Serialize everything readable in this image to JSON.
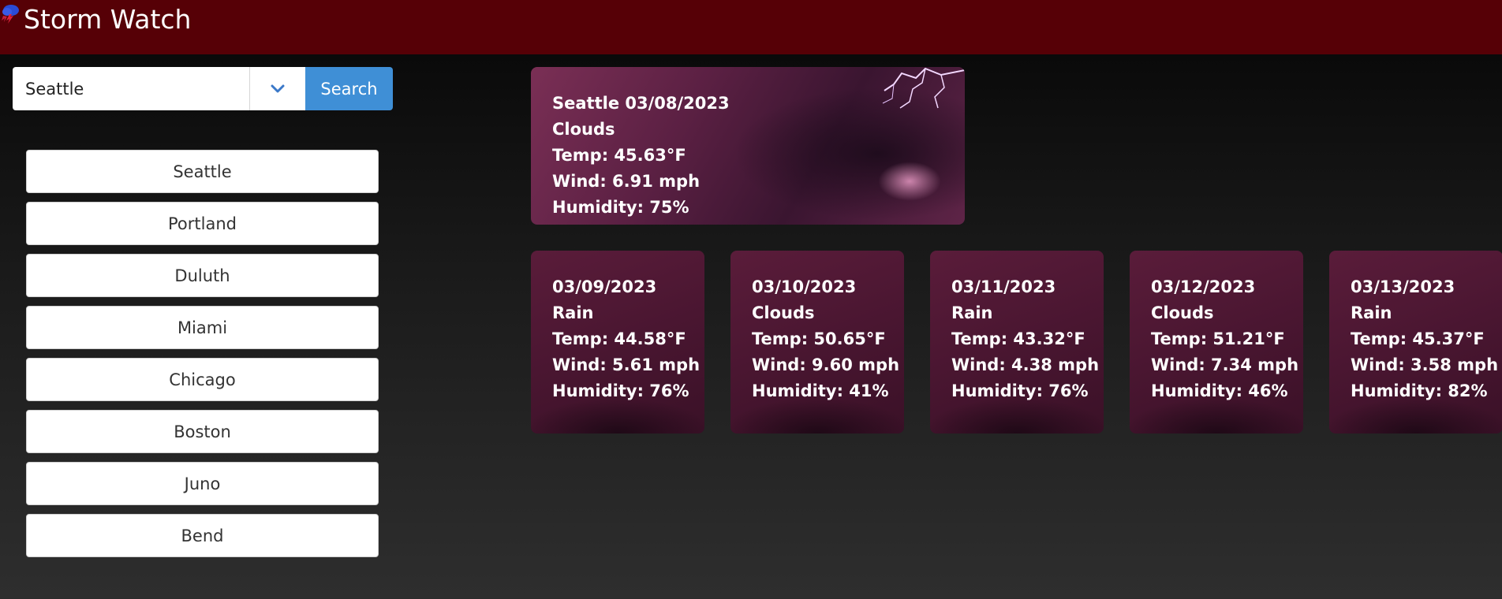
{
  "app": {
    "title": "Storm Watch",
    "logo_icon": "storm-logo-icon"
  },
  "search": {
    "value": "Seattle",
    "dropdown_icon": "chevron-down-icon",
    "button_label": "Search",
    "accent_color": "#3f8fd6"
  },
  "history": [
    "Seattle",
    "Portland",
    "Duluth",
    "Miami",
    "Chicago",
    "Boston",
    "Juno",
    "Bend"
  ],
  "current": {
    "heading": "Seattle 03/08/2023",
    "condition": "Clouds",
    "temp": "Temp: 45.63°F",
    "wind": "Wind: 6.91 mph",
    "humidity": "Humidity: 75%"
  },
  "forecast": [
    {
      "date": "03/09/2023",
      "condition": "Rain",
      "temp": "Temp: 44.58°F",
      "wind": "Wind: 5.61 mph",
      "humidity": "Humidity: 76%"
    },
    {
      "date": "03/10/2023",
      "condition": "Clouds",
      "temp": "Temp: 50.65°F",
      "wind": "Wind: 9.60 mph",
      "humidity": "Humidity: 41%"
    },
    {
      "date": "03/11/2023",
      "condition": "Rain",
      "temp": "Temp: 43.32°F",
      "wind": "Wind: 4.38 mph",
      "humidity": "Humidity: 76%"
    },
    {
      "date": "03/12/2023",
      "condition": "Clouds",
      "temp": "Temp: 51.21°F",
      "wind": "Wind: 7.34 mph",
      "humidity": "Humidity: 46%"
    },
    {
      "date": "03/13/2023",
      "condition": "Rain",
      "temp": "Temp: 45.37°F",
      "wind": "Wind: 3.58 mph",
      "humidity": "Humidity: 82%"
    }
  ],
  "colors": {
    "header": "#560006",
    "card": "#5a1c3a"
  }
}
